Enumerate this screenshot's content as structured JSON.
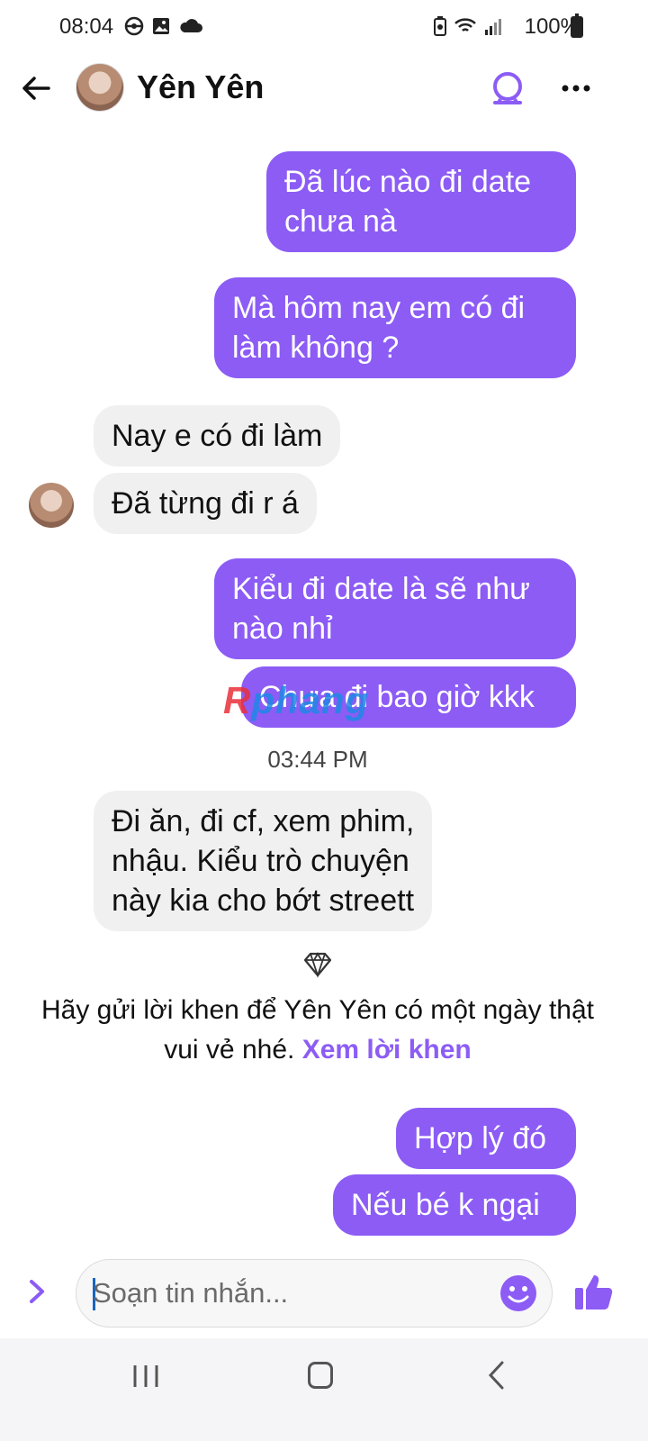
{
  "status_bar": {
    "time": "08:04",
    "battery": "100%",
    "left_icons": [
      "steering-wheel-icon",
      "image-icon",
      "cloud-icon"
    ],
    "right_icons": [
      "battery-saver-icon",
      "wifi-icon",
      "signal-icon",
      "battery-icon"
    ]
  },
  "header": {
    "contact_name": "Yên Yên",
    "icons": [
      "back-arrow-icon",
      "avatar",
      "call-icon",
      "more-icon"
    ]
  },
  "messages": [
    {
      "id": "m1",
      "dir": "out",
      "text": "Đã lúc nào đi date\nchưa nà"
    },
    {
      "id": "m2",
      "dir": "out",
      "text": "Mà hôm nay em có đi\nlàm không ?"
    },
    {
      "id": "m3",
      "dir": "in",
      "text": "Nay e có đi làm"
    },
    {
      "id": "m4",
      "dir": "in",
      "text": "Đã từng đi r á"
    },
    {
      "id": "m5",
      "dir": "out",
      "text": "Kiểu đi date là sẽ như\nnào nhỉ"
    },
    {
      "id": "m6",
      "dir": "out",
      "text": "Chưa đi bao giờ kkk"
    },
    {
      "id": "m7",
      "dir": "in",
      "text": "Đi ăn, đi cf, xem phim,\nnhậu. Kiểu trò chuyện\nnày kia cho bớt streett"
    },
    {
      "id": "m8",
      "dir": "out",
      "text": "Hợp lý đó"
    },
    {
      "id": "m9",
      "dir": "out",
      "text": "Nếu bé k ngại"
    }
  ],
  "timestamp": "03:44 PM",
  "watermark": {
    "first_letter": "R",
    "rest": "phang"
  },
  "compliment": {
    "text": "Hãy gửi lời khen để Yên Yên có một ngày thật vui vẻ nhé.",
    "link": "Xem lời khen"
  },
  "composer": {
    "placeholder": "Soạn tin nhắn...",
    "value": ""
  },
  "colors": {
    "accent": "#8c5cf5",
    "incoming_bubble": "#f0f0f0",
    "outgoing_text": "#ffffff"
  }
}
